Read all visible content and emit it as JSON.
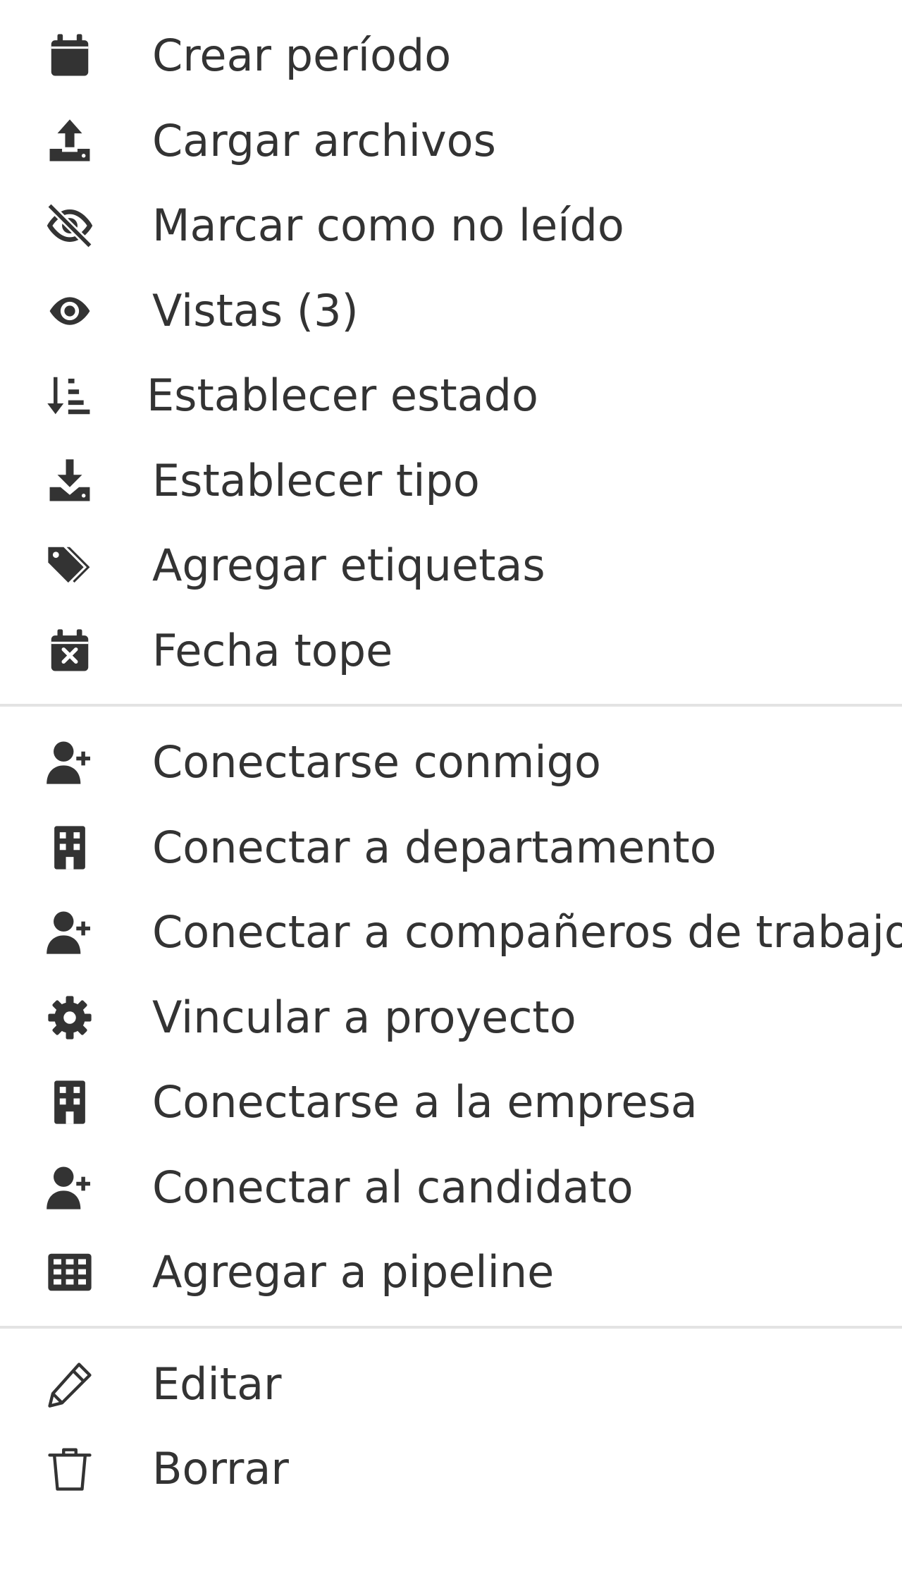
{
  "menu": {
    "group1": [
      {
        "label": "Crear período",
        "icon": "calendar-icon"
      },
      {
        "label": "Cargar archivos",
        "icon": "upload-icon"
      },
      {
        "label": "Marcar como no leído",
        "icon": "eye-slash-icon"
      },
      {
        "label": "Vistas (3)",
        "icon": "eye-icon"
      },
      {
        "label": "Establecer estado",
        "icon": "sort-amount-down-icon"
      },
      {
        "label": "Establecer tipo",
        "icon": "download-icon"
      },
      {
        "label": "Agregar etiquetas",
        "icon": "tags-icon"
      },
      {
        "label": "Fecha tope",
        "icon": "calendar-x-icon"
      }
    ],
    "group2": [
      {
        "label": "Conectarse conmigo",
        "icon": "user-plus-icon"
      },
      {
        "label": "Conectar a departamento",
        "icon": "building-icon"
      },
      {
        "label": "Conectar a compañeros de trabajo",
        "icon": "user-plus-icon"
      },
      {
        "label": "Vincular a proyecto",
        "icon": "gear-icon"
      },
      {
        "label": "Conectarse a la empresa",
        "icon": "building-icon"
      },
      {
        "label": "Conectar al candidato",
        "icon": "user-plus-icon"
      },
      {
        "label": "Agregar a pipeline",
        "icon": "table-icon"
      }
    ],
    "group3": [
      {
        "label": "Editar",
        "icon": "pencil-icon"
      },
      {
        "label": "Borrar",
        "icon": "trash-icon"
      }
    ]
  },
  "colors": {
    "text": "#333333",
    "divider": "#e3e3e3"
  }
}
